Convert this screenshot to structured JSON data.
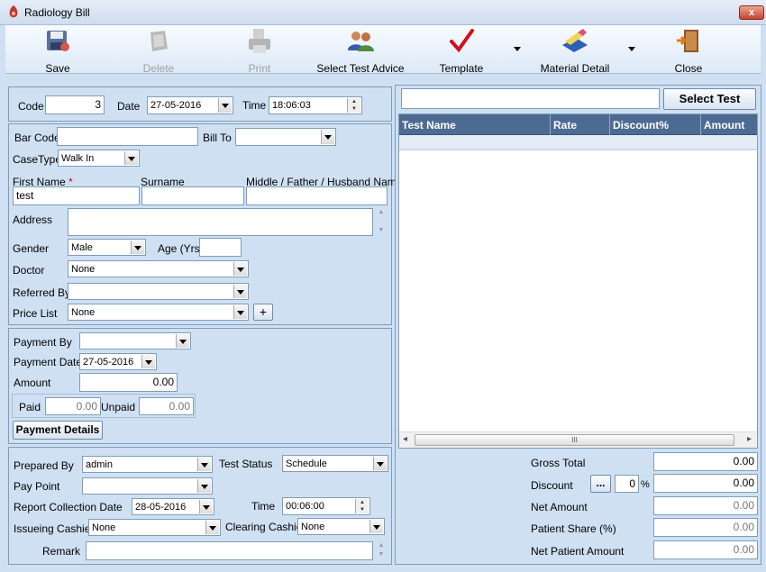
{
  "window": {
    "title": "Radiology Bill",
    "close_glyph": "x"
  },
  "toolbar": {
    "save": "Save",
    "delete": "Delete",
    "print": "Print",
    "select_test_advice": "Select Test Advice",
    "template": "Template",
    "material_detail": "Material Detail",
    "close": "Close"
  },
  "header": {
    "code_label": "Code",
    "code_value": "3",
    "date_label": "Date",
    "date_value": "27-05-2016",
    "time_label": "Time",
    "time_value": "18:06:03"
  },
  "patient": {
    "barcode_label": "Bar Code",
    "barcode_value": "",
    "billto_label": "Bill To",
    "billto_value": "",
    "casetype_label": "CaseType",
    "casetype_value": "Walk In",
    "firstname_label": "First Name",
    "required_mark": "*",
    "firstname_value": "test",
    "surname_label": "Surname",
    "surname_value": "",
    "middle_label": "Middle / Father / Husband Name",
    "middle_value": "",
    "address_label": "Address",
    "address_value": "",
    "gender_label": "Gender",
    "gender_value": "Male",
    "age_label": "Age (Yrs)",
    "age_value": "",
    "doctor_label": "Doctor",
    "doctor_value": "None",
    "referred_label": "Referred By",
    "referred_value": "",
    "pricelist_label": "Price List",
    "pricelist_value": "None",
    "add_glyph": "+"
  },
  "payment": {
    "payment_by_label": "Payment By",
    "payment_by_value": "",
    "payment_date_label": "Payment Date",
    "payment_date_value": "27-05-2016",
    "amount_label": "Amount",
    "amount_value": "0.00",
    "paid_label": "Paid",
    "paid_value": "0.00",
    "unpaid_label": "Unpaid",
    "unpaid_value": "0.00",
    "details_button": "Payment Details"
  },
  "report": {
    "prepared_by_label": "Prepared By",
    "prepared_by_value": "admin",
    "test_status_label": "Test Status",
    "test_status_value": "Schedule",
    "pay_point_label": "Pay Point",
    "pay_point_value": "",
    "collection_date_label": "Report Collection Date",
    "collection_date_value": "28-05-2016",
    "time_label": "Time",
    "time_value": "00:06:00",
    "issuing_cashier_label": "Issueing Cashier",
    "issuing_cashier_value": "None",
    "clearing_cashier_label": "Clearing Cashier",
    "clearing_cashier_value": "None",
    "remark_label": "Remark",
    "remark_value": ""
  },
  "tests": {
    "search_value": "",
    "select_button": "Select Test",
    "columns": [
      "Test Name",
      "Rate",
      "Discount%",
      "Amount"
    ],
    "rows": [],
    "scroll_left": "◂",
    "scroll_right": "▸",
    "scroll_thumb": "III"
  },
  "totals": {
    "gross_total_label": "Gross Total",
    "gross_total_value": "0.00",
    "discount_label": "Discount",
    "discount_button": "...",
    "discount_percent": "0",
    "percent_sign": "%",
    "discount_value": "0.00",
    "net_amount_label": "Net Amount",
    "net_amount_value": "0.00",
    "patient_share_label": "Patient Share (%)",
    "patient_share_value": "0.00",
    "net_patient_amount_label": "Net Patient Amount",
    "net_patient_amount_value": "0.00"
  }
}
